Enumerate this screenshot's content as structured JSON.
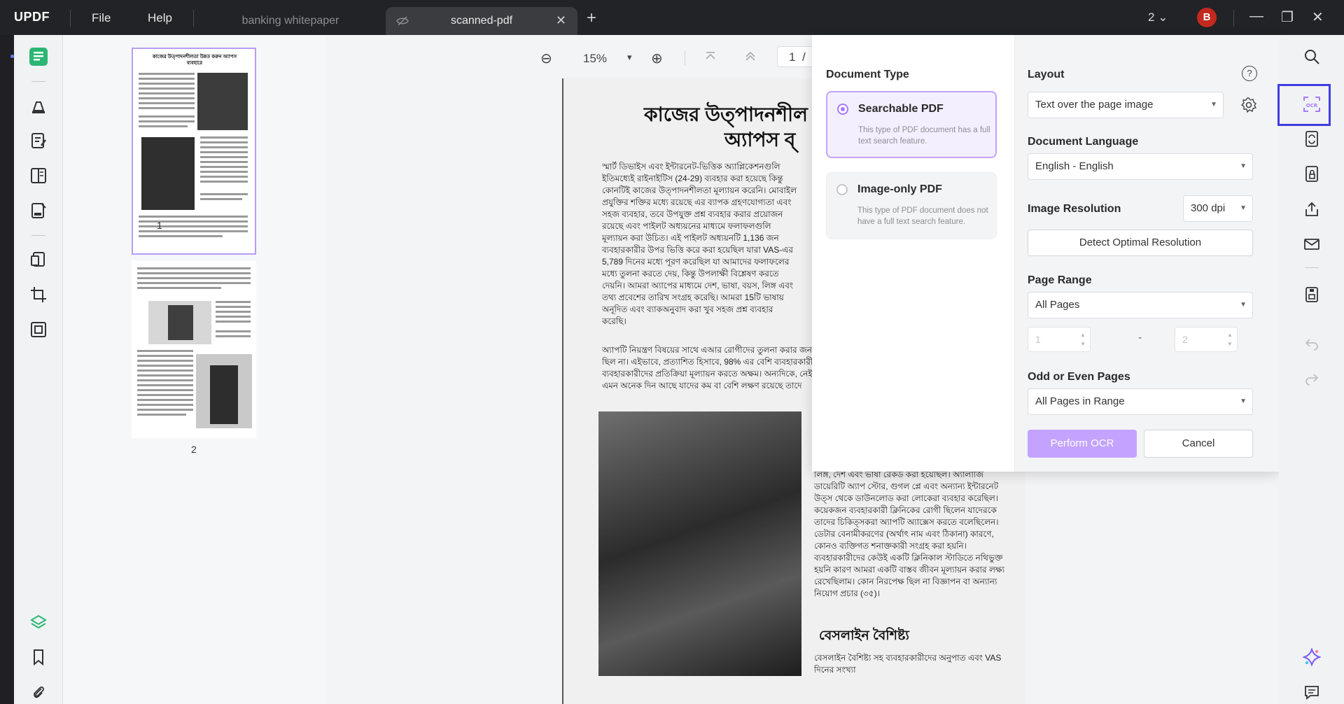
{
  "app": {
    "logo": "UPDF",
    "menu": {
      "file": "File",
      "help": "Help"
    },
    "tabs": [
      {
        "label": "banking whitepaper",
        "active": false
      },
      {
        "label": "scanned-pdf",
        "active": true
      }
    ],
    "tab_close": "✕",
    "new_tab": "+",
    "window_count": "2",
    "window_count_arrow": "⌄",
    "avatar_letter": "B",
    "window_buttons": {
      "minimize": "—",
      "restore": "❐",
      "close": "✕"
    }
  },
  "viewer_toolbar": {
    "zoom_out": "⊖",
    "zoom_value": "15%",
    "zoom_arrow": "▾",
    "zoom_in": "⊕",
    "first_page": "⌅",
    "prev_page": "︿",
    "current_page": "1",
    "page_separator": "/"
  },
  "thumbnails": [
    {
      "number": "1",
      "selected": true,
      "heading": "কাজের উত্পাদনশীলতা উন্নত করুন অ্যাপস ব্যবহারে"
    },
    {
      "number": "2",
      "selected": false
    }
  ],
  "document": {
    "heading_line1": "কাজের উত্পাদনশীল",
    "heading_line2": "অ্যাপস ব্",
    "para1": "স্মার্ট ডিভাইস এবং ইন্টারনেট-ভিত্তিক অ্যাপ্লিকেশনগুলি ইতিমধ্যেই রাইনাইটিস (24-29) ব্যবহার করা হয়েছে কিন্তু কোনটিই কাজের উত্পাদনশীলতা মূল্যায়ন করেনি। মোবাইল প্রযুক্তির শক্তির মধ্যে রয়েছে এর ব্যাপক গ্রহণযোগ্যতা এবং সহজ ব্যবহার, তবে উপযুক্ত প্রশ্ন ব্যবহার করার প্রয়োজন রয়েছে এবং পাইলট অধ্যয়নের মাধ্যমে ফলাফলগুলি মূল্যায়ন করা উচিত। এই পাইলট অধ্যয়নটি 1,136 জন ব্যবহারকারীর উপর ভিত্তি করে করা হয়েছিল যারা VAS-এর 5,789 দিনের মধ্যে পূরণ করেছিল যা আমাদের ফলাফলের মধ্যে তুলনা করতে দেয়, কিন্তু উপলাক্ষী বিশ্লেষণ করতে দেয়নি। আমরা অ্যাপের মাধ্যমে দেশ, ভাষা, বয়স, লিঙ্গ এবং তথ্য প্রবেশের তারিখ সংগ্রহ করেছি। আমরা 15টি ভাষায় অনূদিত এবং ব্যাকঅনুবাদ করা খুব সহজ প্রশ্ন ব্যবহার করেছি।",
    "para2": "অ্যাপটি নিয়ন্ত্রণ বিষয়ের সাথে এআর রোগীদের তুলনা করার জন ছিল না। এইভাবে, প্রত্যাশিত হিসাবে, 98% এর বেশি ব্যবহারকারী ব্যবহারকারীদের প্রতিক্রিয়া মূল্যায়ন করতে অক্ষম। অন্যদিকে, নেই এমন অনেক দিন আছে যাদের কম বা বেশি লক্ষণ রয়েছে তাদে",
    "para3": "লিঙ্গ, দেশ এবং ভাষা রেকর্ড করা হয়েছিল। অ্যালার্জি ডায়েরিটি অ্যাপ স্টোর, গুগল প্লে এবং অন্যান্য ইন্টারনেট উত্স থেকে ডাউনলোড করা লোকেরা ব্যবহার করেছিল। কয়েকজন ব্যবহারকারী ক্লিনিকের রোগী ছিলেন যাদেরকে তাদের চিকিত্সকরা অ্যাপটি অ্যাক্সেস করতে বলেছিলেন। ডেটার বেনামীকরণের (অর্থাৎ নাম এবং ঠিকানা) কারণে, কোনও ব্যক্তিগত শনাক্তকারী সংগ্রহ করা হয়নি। ব্যবহারকারীদের কেউই একটি ক্লিনিকাল স্টাডিতে নথিভুক্ত হয়নি কারণ আমরা একটি বাস্তব জীবন মূল্যায়ন করার লক্ষ্য রেখেছিলাম। কোন নিরপেক্ষ ছিল না বিজ্ঞাপন বা অন্যান্য নিয়োগ প্রচার (৩৫)।",
    "subheading": "বেসলাইন বৈশিষ্ট্য",
    "para4": "বেসলাইন বৈশিষ্ট্য সহ ব্যবহারকারীদের অনুপাত এবং VAS দিনের সংখ্যা"
  },
  "ocr_panel": {
    "document_type_title": "Document Type",
    "options": [
      {
        "title": "Searchable PDF",
        "description": "This type of PDF document has a full text search feature.",
        "selected": true
      },
      {
        "title": "Image-only PDF",
        "description": "This type of PDF document does not have a full text search feature.",
        "selected": false
      }
    ],
    "layout_title": "Layout",
    "help_icon": "?",
    "layout_value": "Text over the page image",
    "language_title": "Document Language",
    "language_value": "English - English",
    "resolution_title": "Image Resolution",
    "resolution_value": "300 dpi",
    "detect_button": "Detect Optimal Resolution",
    "page_range_title": "Page Range",
    "page_range_value": "All Pages",
    "range_from": "1",
    "range_dash": "-",
    "range_to": "2",
    "odd_even_title": "Odd or Even Pages",
    "odd_even_value": "All Pages in Range",
    "perform_button": "Perform OCR",
    "cancel_button": "Cancel",
    "dropdown_arrow": "▼",
    "stepper_arrows": "▲▼"
  },
  "colors": {
    "accent": "#a679ff",
    "ocr_highlight_border": "#3f3de0",
    "avatar": "#c3291e",
    "sidebar_active": "#2bb673"
  }
}
